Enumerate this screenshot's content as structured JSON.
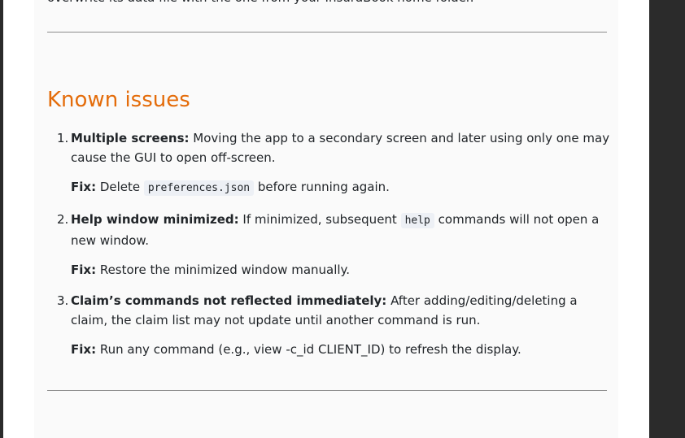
{
  "previous_section": {
    "trailing_text": "overwrite its data file with the one from your InsuraBook home folder."
  },
  "known_issues": {
    "heading": "Known issues",
    "items": [
      {
        "number": "1.",
        "title": "Multiple screens:",
        "desc_before": " Moving the app to a secondary screen and later using only one may cause the GUI to open off-screen.",
        "code": "",
        "desc_after": "",
        "fix_label": "Fix:",
        "fix_before": " Delete ",
        "fix_code": "preferences.json",
        "fix_after": " before running again."
      },
      {
        "number": "2.",
        "title": "Help window minimized:",
        "desc_before": " If minimized, subsequent ",
        "code": "help",
        "desc_after": " commands will not open a new window.",
        "fix_label": "Fix:",
        "fix_before": " Restore the minimized window manually.",
        "fix_code": "",
        "fix_after": ""
      },
      {
        "number": "3.",
        "title": "Claim’s commands not reflected immediately:",
        "desc_before": " After adding/editing/deleting a claim, the claim list may not update until another command is run.",
        "code": "",
        "desc_after": "",
        "fix_label": "Fix:",
        "fix_before": " Run any command (e.g., view -c_id CLIENT_ID) to refresh the display.",
        "fix_code": "",
        "fix_after": ""
      }
    ]
  },
  "colors": {
    "heading": "#e46c0a",
    "page_background": "#fafafa",
    "code_background": "#edf0f5",
    "viewer_dark": "#2b2b2b"
  }
}
